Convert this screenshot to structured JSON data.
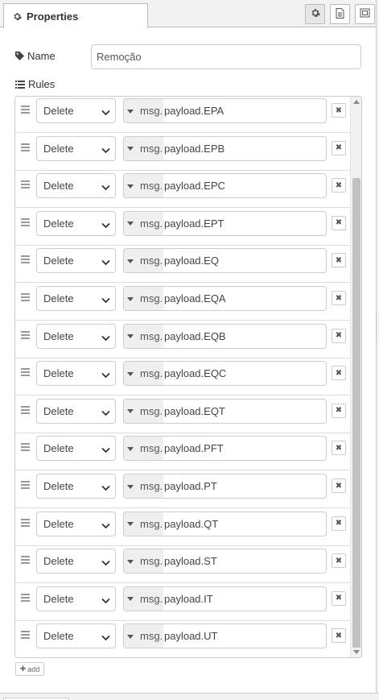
{
  "tabs": {
    "active_label": "Properties"
  },
  "toolbar": {
    "buttons": [
      {
        "name": "settings-tab",
        "icon": "gear-icon"
      },
      {
        "name": "description-tab",
        "icon": "document-icon"
      },
      {
        "name": "appearance-tab",
        "icon": "frame-icon"
      }
    ]
  },
  "name_field": {
    "label": "Name",
    "value": "Remoção"
  },
  "rules": {
    "label": "Rules",
    "items": [
      {
        "action": "Delete",
        "type": "msg.",
        "value": "payload.EPA"
      },
      {
        "action": "Delete",
        "type": "msg.",
        "value": "payload.EPB"
      },
      {
        "action": "Delete",
        "type": "msg.",
        "value": "payload.EPC"
      },
      {
        "action": "Delete",
        "type": "msg.",
        "value": "payload.EPT"
      },
      {
        "action": "Delete",
        "type": "msg.",
        "value": "payload.EQ"
      },
      {
        "action": "Delete",
        "type": "msg.",
        "value": "payload.EQA"
      },
      {
        "action": "Delete",
        "type": "msg.",
        "value": "payload.EQB"
      },
      {
        "action": "Delete",
        "type": "msg.",
        "value": "payload.EQC"
      },
      {
        "action": "Delete",
        "type": "msg.",
        "value": "payload.EQT"
      },
      {
        "action": "Delete",
        "type": "msg.",
        "value": "payload.PFT"
      },
      {
        "action": "Delete",
        "type": "msg.",
        "value": "payload.PT"
      },
      {
        "action": "Delete",
        "type": "msg.",
        "value": "payload.QT"
      },
      {
        "action": "Delete",
        "type": "msg.",
        "value": "payload.ST"
      },
      {
        "action": "Delete",
        "type": "msg.",
        "value": "payload.IT"
      },
      {
        "action": "Delete",
        "type": "msg.",
        "value": "payload.UT"
      }
    ],
    "add_label": "add"
  },
  "colors": {
    "border": "#cccccc",
    "panel_bg": "#f3f3f3",
    "type_button_bg": "#efefef"
  }
}
